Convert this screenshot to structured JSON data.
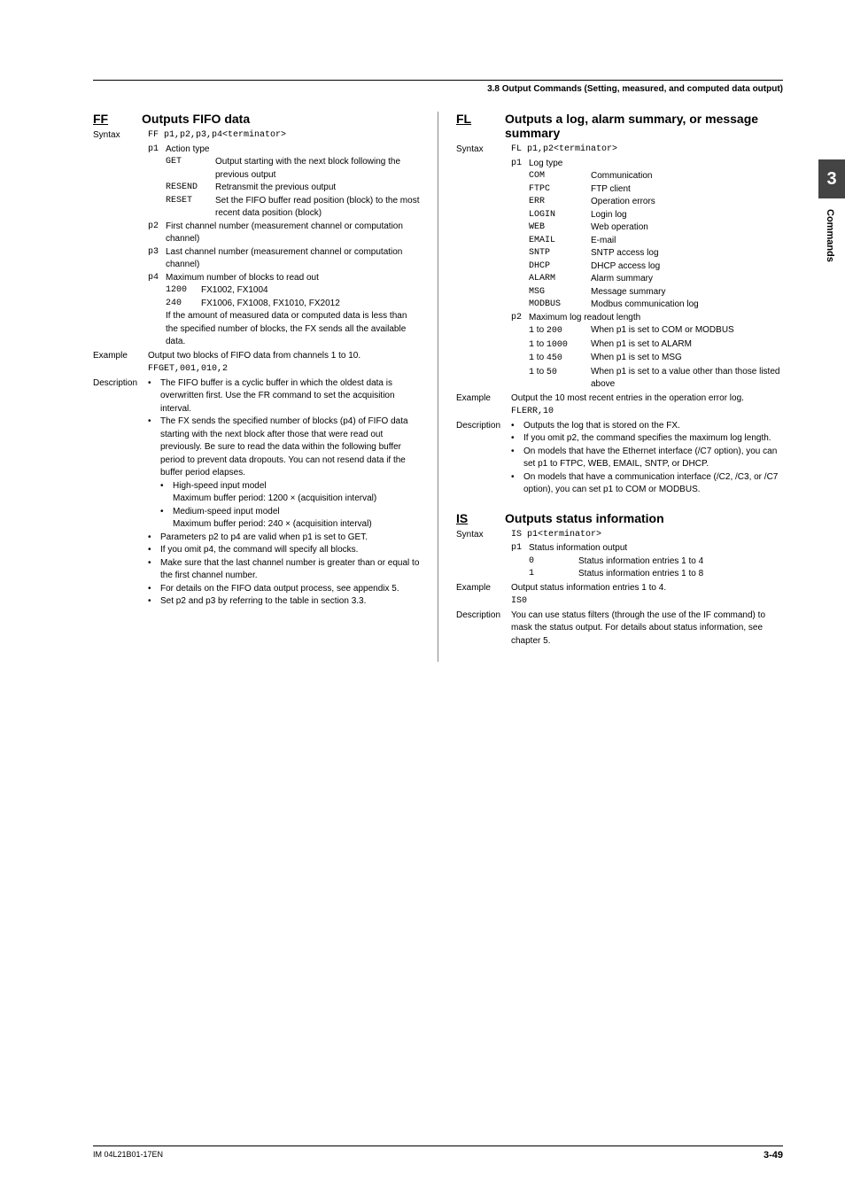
{
  "header": "3.8  Output Commands (Setting, measured, and computed data output)",
  "tab": {
    "num": "3",
    "text": "Commands"
  },
  "footer": {
    "left": "IM 04L21B01-17EN",
    "right": "3-49"
  },
  "ff": {
    "name": "FF",
    "title": "Outputs FIFO data",
    "syntaxLabel": "Syntax",
    "syntax": "FF p1,p2,p3,p4<terminator>",
    "p1": {
      "key": "p1",
      "label": "Action type"
    },
    "p1opts": [
      {
        "k": "GET",
        "v": "Output starting with the next block following the previous output"
      },
      {
        "k": "RESEND",
        "v": "Retransmit the previous output"
      },
      {
        "k": "RESET",
        "v": "Set the FIFO buffer read position (block) to the most recent data position (block)"
      }
    ],
    "p2": {
      "key": "p2",
      "v": "First channel number (measurement channel or computation channel)"
    },
    "p3": {
      "key": "p3",
      "v": "Last channel number (measurement channel or computation channel)"
    },
    "p4": {
      "key": "p4",
      "v": "Maximum number of blocks to read out"
    },
    "p4opts": [
      {
        "k": "1200",
        "v": "FX1002, FX1004"
      },
      {
        "k": "240",
        "v": "FX1006, FX1008, FX1010, FX2012"
      }
    ],
    "p4note": "If the amount of measured data or computed data is less than the specified number of blocks, the FX sends all the available data.",
    "exLabel": "Example",
    "exText": "Output two blocks of FIFO data from channels 1 to 10.",
    "exCode": "FFGET,001,010,2",
    "descLabel": "Description",
    "desc": [
      "The FIFO buffer is a cyclic buffer in which the oldest data is overwritten first. Use the FR command to set the acquisition interval.",
      "The FX sends the specified number of blocks (p4) of FIFO data starting with the next block after those that were read out previously. Be sure to read the data within the following buffer period to prevent data dropouts. You can not resend data if the buffer period elapses."
    ],
    "subA": {
      "t": "High-speed input model",
      "v": "Maximum buffer period: 1200 × (acquisition interval)"
    },
    "subB": {
      "t": "Medium-speed input model",
      "v": "Maximum buffer period: 240 × (acquisition interval)"
    },
    "desc2": [
      "Parameters p2 to p4 are valid when p1 is set to GET.",
      "If you omit p4, the command will specify all blocks.",
      "Make sure that the last channel number is greater than or equal to the first channel number.",
      "For details on the FIFO data output process, see appendix 5.",
      "Set p2 and p3 by referring to the table in section 3.3."
    ]
  },
  "fl": {
    "name": "FL",
    "title": "Outputs a log, alarm summary, or message summary",
    "syntaxLabel": "Syntax",
    "syntax": "FL p1,p2<terminator>",
    "p1": {
      "key": "p1",
      "label": "Log type"
    },
    "p1opts": [
      {
        "k": "COM",
        "v": "Communication"
      },
      {
        "k": "FTPC",
        "v": "FTP client"
      },
      {
        "k": "ERR",
        "v": "Operation errors"
      },
      {
        "k": "LOGIN",
        "v": "Login log"
      },
      {
        "k": "WEB",
        "v": "Web operation"
      },
      {
        "k": "EMAIL",
        "v": "E-mail"
      },
      {
        "k": "SNTP",
        "v": "SNTP access log"
      },
      {
        "k": "DHCP",
        "v": "DHCP access log"
      },
      {
        "k": "ALARM",
        "v": "Alarm summary"
      },
      {
        "k": "MSG",
        "v": "Message summary"
      },
      {
        "k": "MODBUS",
        "v": "Modbus communication log"
      }
    ],
    "p2": {
      "key": "p2",
      "label": "Maximum log readout length"
    },
    "p2opts": [
      {
        "k": "1 to 200",
        "v": "When p1 is set to COM or MODBUS"
      },
      {
        "k": "1 to 1000",
        "v": "When p1 is set to ALARM"
      },
      {
        "k": "1 to 450",
        "v": "When p1 is set to MSG"
      },
      {
        "k": "1 to 50",
        "v": "When p1 is set to a value other than those listed above"
      }
    ],
    "exLabel": "Example",
    "exText": "Output the 10 most recent entries in the operation error log.",
    "exCode": "FLERR,10",
    "descLabel": "Description",
    "desc": [
      "Outputs the log that is stored on the FX.",
      "If you omit p2, the command specifies the maximum log length.",
      "On models that have the Ethernet interface (/C7 option), you can set p1 to FTPC, WEB, EMAIL, SNTP, or DHCP.",
      "On models that have a communication interface (/C2, /C3, or /C7 option), you can set p1 to COM or MODBUS."
    ]
  },
  "is": {
    "name": "IS",
    "title": "Outputs status information",
    "syntaxLabel": "Syntax",
    "syntax": "IS p1<terminator>",
    "p1": {
      "key": "p1",
      "label": "Status information output"
    },
    "p1opts": [
      {
        "k": "0",
        "v": "Status information entries 1 to 4"
      },
      {
        "k": "1",
        "v": "Status information entries 1 to 8"
      }
    ],
    "exLabel": "Example",
    "exText": "Output status information entries 1 to 4.",
    "exCode": "IS0",
    "descLabel": "Description",
    "descText": "You can use status filters (through the use of the IF command) to mask the status output. For details about status information, see chapter 5."
  }
}
